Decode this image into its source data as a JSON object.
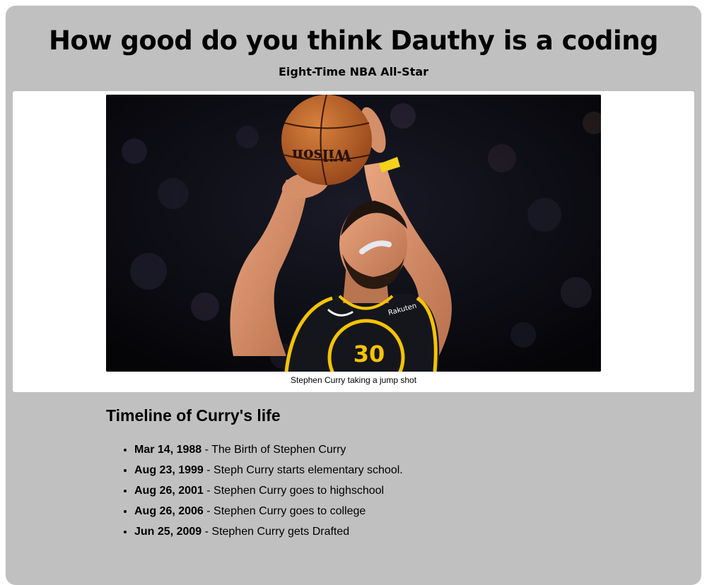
{
  "header": {
    "title": "How good do you think Dauthy is a coding",
    "subtitle": "Eight-Time NBA All-Star"
  },
  "figure": {
    "image_alt": "Stephen Curry taking a jump shot",
    "caption": "Stephen Curry taking a jump shot",
    "jersey_number": "30",
    "ball_brand": "Wilson",
    "jersey_sponsor": "Rakuten"
  },
  "timeline": {
    "heading": "Timeline of Curry's life",
    "items": [
      {
        "date": "Mar 14, 1988",
        "event": " - The Birth of Stephen Curry"
      },
      {
        "date": "Aug 23, 1999",
        "event": " - Steph Curry starts elementary school."
      },
      {
        "date": "Aug 26, 2001",
        "event": " - Stephen Curry goes to highschool"
      },
      {
        "date": "Aug 26, 2006",
        "event": " - Stephen Curry goes to college"
      },
      {
        "date": "Jun 25, 2009",
        "event": " - Stephen Curry gets Drafted"
      }
    ]
  },
  "colors": {
    "page_background": "#c0c0c0",
    "figure_background": "#ffffff",
    "jersey": "#15161c",
    "jersey_trim": "#f5c400"
  }
}
